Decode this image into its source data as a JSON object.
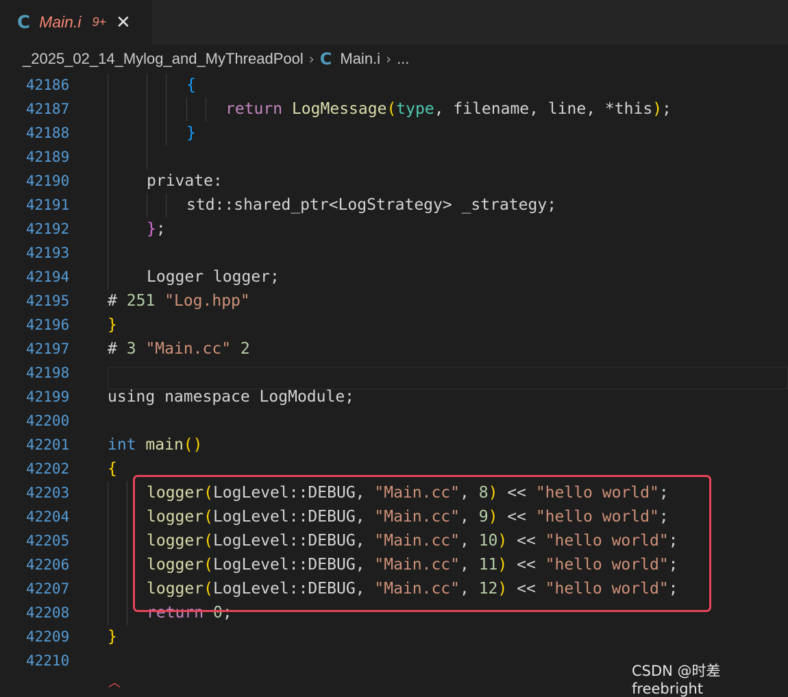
{
  "tab": {
    "icon": "c-language-icon",
    "icon_text": "C",
    "name": "Main.i",
    "problems_badge": "9+",
    "close": "✕"
  },
  "breadcrumb": {
    "folder": "_2025_02_14_Mylog_and_MyThreadPool",
    "sep": "›",
    "file_icon_text": "C",
    "file": "Main.i",
    "more": "..."
  },
  "editor": {
    "line_numbers": [
      "42186",
      "42187",
      "42188",
      "42189",
      "42190",
      "42191",
      "42192",
      "42193",
      "42194",
      "42195",
      "42196",
      "42197",
      "42198",
      "42199",
      "42200",
      "42201",
      "42202",
      "42203",
      "42204",
      "42205",
      "42206",
      "42207",
      "42208",
      "42209",
      "42210"
    ],
    "code": {
      "l0_brace": "{",
      "l1_kw": "return",
      "l1_fn": "LogMessage",
      "l1_open": "(",
      "l1_arg1": "type",
      "l1_rest": ", filename, line, *this",
      "l1_close": ")",
      "l1_semi": ";",
      "l2_brace": "}",
      "l4": "private:",
      "l5": "std::shared_ptr<LogStrategy> _strategy;",
      "l6_brace": "}",
      "l6_semi": ";",
      "l8": "Logger logger;",
      "l9_hash": "#",
      "l9_num": "251",
      "l9_str": "\"Log.hpp\"",
      "l10_brace": "}",
      "l11_hash": "#",
      "l11_num": "3",
      "l11_str": "\"Main.cc\"",
      "l11_flag": "2",
      "l13": "using namespace LogModule;",
      "l15_type": "int",
      "l15_fn": "main",
      "l15_parens": "()",
      "l16_brace": "{",
      "call_fn": "logger",
      "call_open": "(",
      "call_arg": "LogLevel::DEBUG",
      "call_comma": ", ",
      "call_file": "\"Main.cc\"",
      "call_close": ")",
      "call_op": " << ",
      "call_msg": "\"hello world\"",
      "call_semi": ";",
      "line_args": [
        "8",
        "9",
        "10",
        "11",
        "12"
      ],
      "l22_kw": "return",
      "l22_num": "0",
      "l22_semi": ";",
      "l23_brace": "}"
    }
  },
  "watermark": "CSDN @时差freebright",
  "colors": {
    "background": "#1e1e1e",
    "line_number": "#569cd6",
    "highlight_box": "#e8455a",
    "tab_name": "#f48771"
  }
}
